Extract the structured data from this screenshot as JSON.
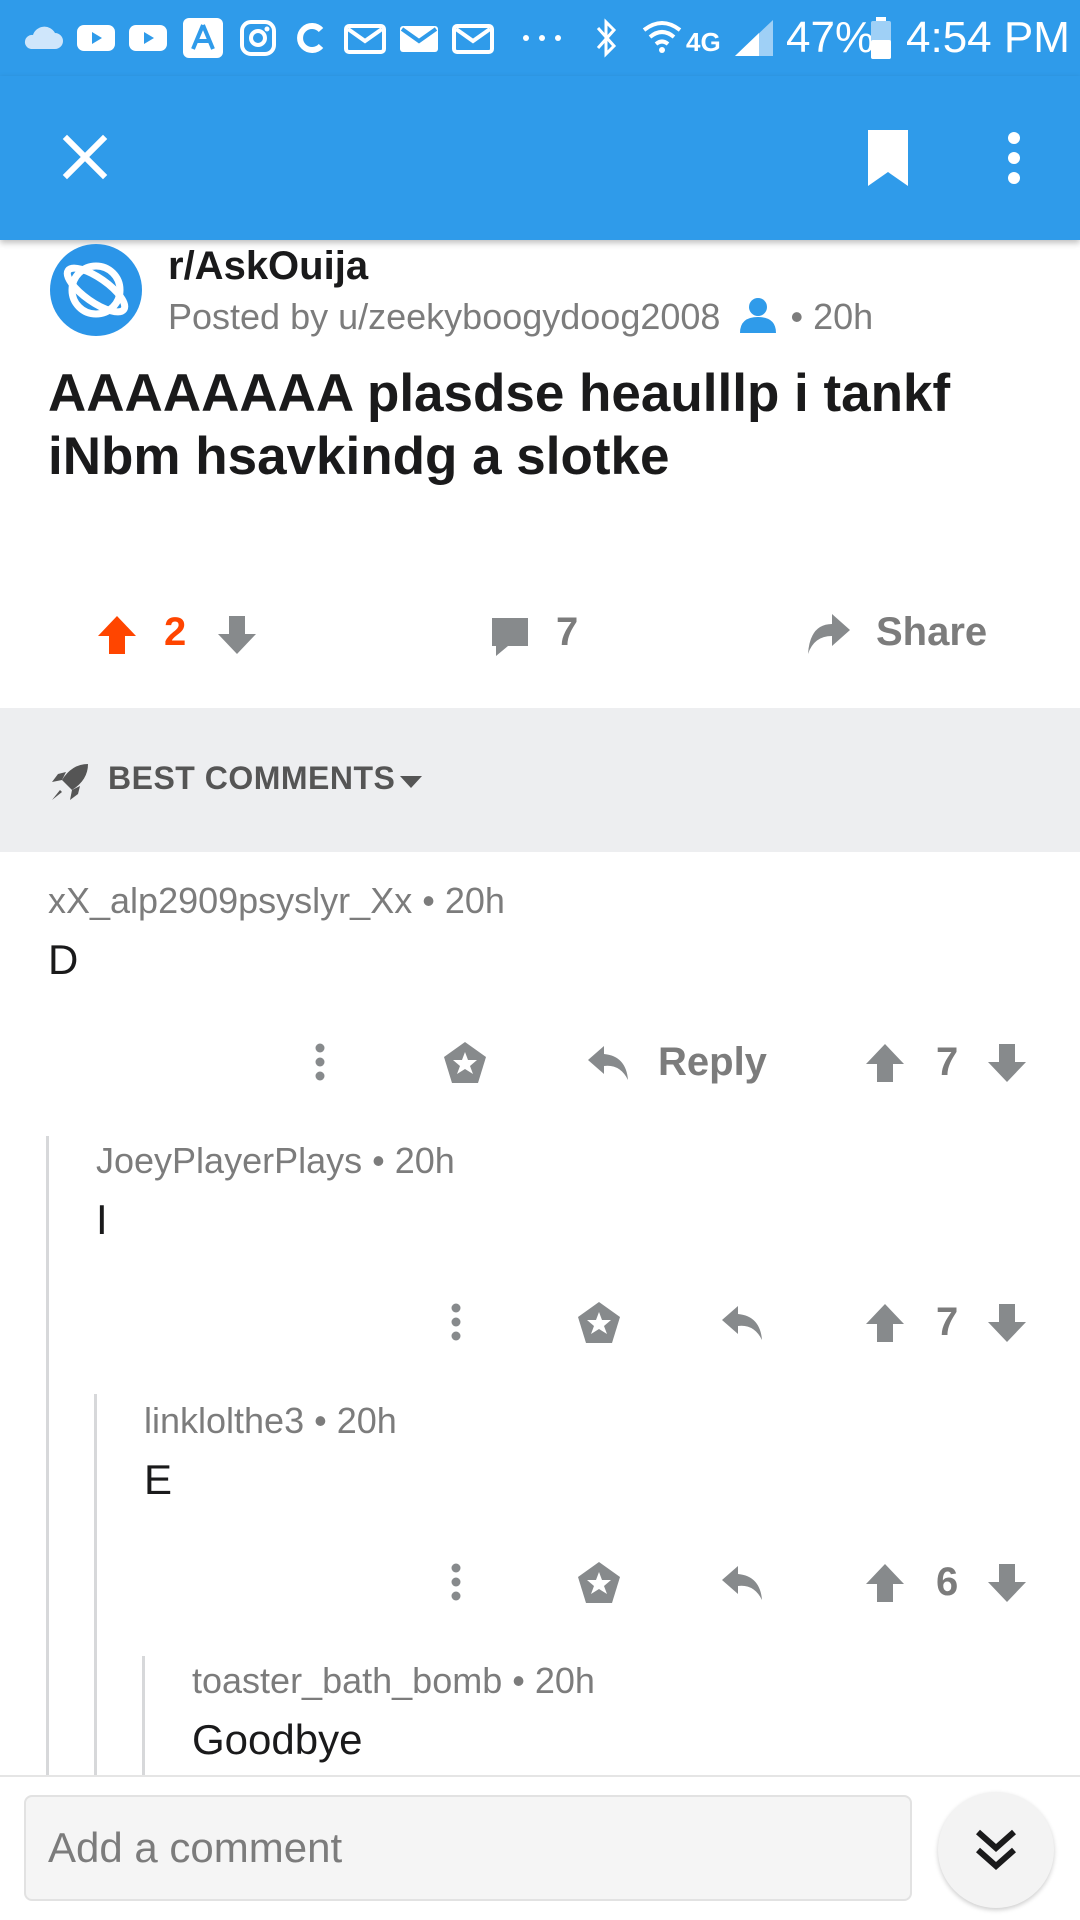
{
  "status_bar": {
    "battery": "47%",
    "time": "4:54 PM",
    "network": "4G",
    "icons": [
      "cloud-icon",
      "youtube-icon",
      "youtube-icon",
      "appstore-icon",
      "instagram-icon",
      "c-app-icon",
      "mail-icon",
      "mail-icon",
      "mail-icon",
      "more-dots-icon",
      "bluetooth-icon",
      "wifi-icon",
      "signal-icon",
      "battery-icon"
    ]
  },
  "app_bar": {
    "icons": [
      "close-icon",
      "bookmark-icon",
      "overflow-menu-icon"
    ]
  },
  "post": {
    "subreddit": "r/AskOuija",
    "posted_by": "Posted by u/zeekyboogydoog2008",
    "age": "• 20h",
    "title": "AAAAAAAA plasdse heaulllp i tankf iNbm hsavkindg a slotke",
    "score": "2",
    "comments_count": "7",
    "share_label": "Share"
  },
  "sort": {
    "label": "BEST COMMENTS"
  },
  "comments": [
    {
      "author": "xX_alp2909psyslyr_Xx",
      "age": "• 20h",
      "body": "D",
      "score": "7",
      "reply_label": "Reply"
    },
    {
      "author": "JoeyPlayerPlays",
      "age": "• 20h",
      "body": "I",
      "score": "7"
    },
    {
      "author": "linklolthe3",
      "age": "• 20h",
      "body": "E",
      "score": "6"
    },
    {
      "author": "toaster_bath_bomb",
      "age": "• 20h",
      "body": "Goodbye"
    }
  ],
  "composer": {
    "placeholder": "Add a comment"
  },
  "colors": {
    "header_blue": "#2f9bea",
    "upvote_orange": "#ff4500",
    "icon_grey": "#878a8c"
  }
}
